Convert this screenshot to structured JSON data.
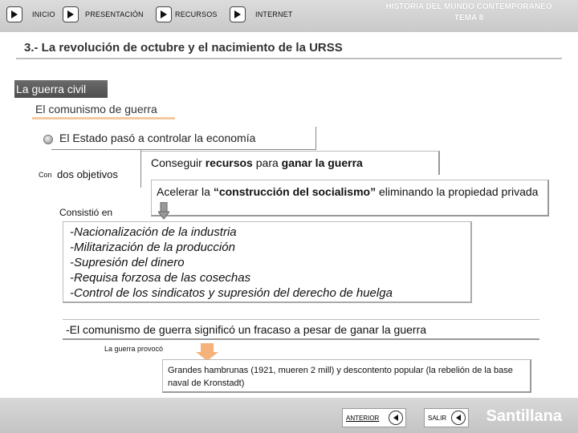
{
  "nav": {
    "items": [
      {
        "label": "INICIO",
        "icon": "play-arrow-icon"
      },
      {
        "label": "PRESENTACIÓN",
        "icon": "play-arrow-icon"
      },
      {
        "label": "RECURSOS",
        "icon": "play-arrow-icon"
      },
      {
        "label": "INTERNET",
        "icon": "play-arrow-icon"
      }
    ],
    "header_line1": "HISTORIA DEL MUNDO CONTEMPORÁNEO",
    "header_line2": "TEMA 8"
  },
  "page": {
    "title": "3.- La revolución de octubre y el nacimiento de la URSS",
    "section": "La guerra civil",
    "subtitle": "El comunismo de guerra",
    "bullet": "El Estado pasó a controlar la economía"
  },
  "diagram": {
    "con_prefix": "Con",
    "con_rest": "dos objetivos",
    "goal1_pre": "Conseguir ",
    "goal1_bold1": "recursos",
    "goal1_mid": " para ",
    "goal1_bold2": "ganar la guerra",
    "goal2_pre": "Acelerar la ",
    "goal2_bold": "“construcción del socialismo”",
    "goal2_post": " eliminando la propiedad privada",
    "consistio_label": "Consistió en",
    "measures": [
      "-Nacionalización de la industria",
      "-Militarización de la producción",
      "-Supresión del dinero",
      "-Requisa forzosa de las cosechas",
      "-Control de los sindicatos y supresión del derecho de huelga"
    ],
    "failure": "-El comunismo de guerra significó un fracaso a pesar de ganar la guerra",
    "provoco_label": "La guerra provocó",
    "famine": "Grandes hambrunas (1921, mueren 2 mill) y descontento popular (la rebelión de la base naval de Kronstadt)"
  },
  "footer": {
    "prev_label": "ANTERIOR",
    "exit_label": "SALIR",
    "brand": "Santillana"
  },
  "colors": {
    "orange_arrow": "#f5b27a",
    "subtitle_rule": "#f3c9a0",
    "section_bg": "#555555"
  }
}
